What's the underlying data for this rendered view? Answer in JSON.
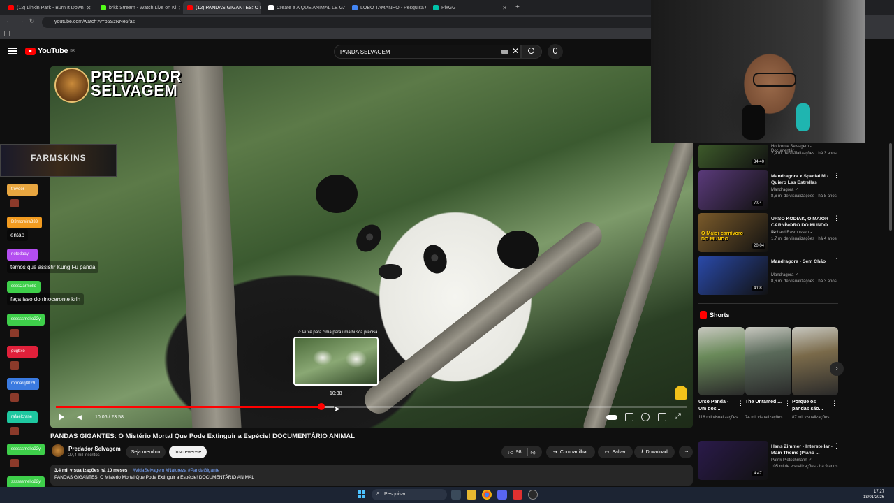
{
  "browser": {
    "tabs": [
      {
        "title": "(12) Linkin Park - Burn It Down",
        "color": "#ff0000"
      },
      {
        "title": "brkk Stream - Watch Live on Ki",
        "color": "#53fc18"
      },
      {
        "title": "(12) PANDAS GIGANTES: O Mi",
        "color": "#ff0000",
        "active": true
      },
      {
        "title": "Create a A QUE ANIMAL LE GA",
        "color": "#ffffff"
      },
      {
        "title": "LOBO TAMANHO - Pesquisa Go",
        "color": "#4285f4"
      },
      {
        "title": "PixGG",
        "color": "#00c2a8"
      }
    ],
    "url": "youtube.com/watch?v=p6SzNNe6fas"
  },
  "youtube": {
    "logo_text": "YouTube",
    "logo_sup": "BR",
    "search_value": "PANDA SELVAGEM"
  },
  "video": {
    "watermark_line1": "PREDADOR",
    "watermark_line2": "SELVAGEM",
    "preview_hint": "☆ Puxe para cima para uma busca precisa",
    "preview_time": "10:38",
    "time_display": "10:06 / 23:58",
    "progress_fraction": 0.42,
    "buffer_fraction": 0.44
  },
  "info": {
    "title": "PANDAS GIGANTES: O Mistério Mortal Que Pode Extinguir a Espécie! DOCUMENTÁRIO ANIMAL",
    "channel": "Predador Selvagem",
    "subscribers": "27,4 mil inscritos",
    "join_label": "Seja membro",
    "subscribe_label": "Inscrever-se",
    "likes": "98",
    "share_label": "Compartilhar",
    "save_label": "Salvar",
    "download_label": "Download",
    "desc_meta": "3,4 mil visualizações  há 10 meses",
    "desc_tags": "#VidaSelvagem #Natureza #PandaGigante",
    "desc_text": "PANDAS GIGANTES: O Mistério Mortal Que Pode Extinguir a Espécie! DOCUMENTÁRIO ANIMAL"
  },
  "chat": {
    "banner": "FARMSKINS",
    "messages": [
      {
        "user": "trovoor",
        "color": "#e8a640",
        "text": ""
      },
      {
        "user": "D3moreira333",
        "color": "#f29b20",
        "text": "então"
      },
      {
        "user": "notedaay",
        "color": "#b44ef0",
        "text": "temos que assistir Kung Fu panda"
      },
      {
        "user": "ssssCarmello",
        "color": "#3ecf4a",
        "text": "faça isso do rinoceronte krlh"
      },
      {
        "user": "ssssssmello22y",
        "color": "#3ecf4a",
        "text": ""
      },
      {
        "user": "gugbxo",
        "color": "#e0203a",
        "text": ""
      },
      {
        "user": "mrmarq8029",
        "color": "#3a7ae0",
        "text": ""
      },
      {
        "user": "rafaelcrane",
        "color": "#1ec8a0",
        "text": ""
      },
      {
        "user": "ssssssmello22y",
        "color": "#3ecf4a",
        "text": ""
      },
      {
        "user": "ssssssmello22y",
        "color": "#3ecf4a",
        "text": ""
      }
    ]
  },
  "sidebar": {
    "recs": [
      {
        "title": "",
        "channel": "Horizonte Selvagem - Documentár...",
        "views": "2,9 mi de visualizações · há 3 anos",
        "duration": "34:40",
        "color": "#3d5a2a"
      },
      {
        "title": "Mandragora x Special M - Quiero Las Estrellas",
        "channel": "Mandragora ✓",
        "views": "8,6 mi de visualizações · há 8 anos",
        "duration": "7:04",
        "color": "#5a3a7a"
      },
      {
        "title": "URSO KODIAK, O MAIOR CARNÍVORO DO MUNDO ...",
        "channel": "Richard Rasmussen ✓",
        "views": "1,7 mi de visualizações · há 4 anos",
        "duration": "20:04",
        "color": "#7a5a2a",
        "thumb_text": "O Maior carnívoro DO MUNDO"
      },
      {
        "title": "Mandragora - Sem Chão",
        "channel": "Mandragora ✓",
        "views": "8,6 mi de visualizações · há 3 anos",
        "duration": "4:08",
        "color": "#2a4aaa"
      },
      {
        "title": "Hans Zimmer - Interstellar - Main Theme (Piano ...",
        "channel": "Patrik Pietschmann ✓",
        "views": "105 mi de visualizações · há 9 anos",
        "duration": "4:47",
        "color": "#2a1a4a"
      }
    ],
    "shorts_title": "Shorts",
    "shorts": [
      {
        "title": "Urso Panda - Um dos ...",
        "views": "116 mil visualizações",
        "color": "#6a8a5a"
      },
      {
        "title": "The Untamed ...",
        "views": "74 mil visualizações",
        "color": "#5a6a5a"
      },
      {
        "title": "Porque os pandas são...",
        "views": "87 mil visualizações",
        "color": "#7a6a4a"
      }
    ]
  },
  "taskbar": {
    "search_label": "Pesquisar",
    "time": "17:27",
    "date": "18/01/2026"
  }
}
